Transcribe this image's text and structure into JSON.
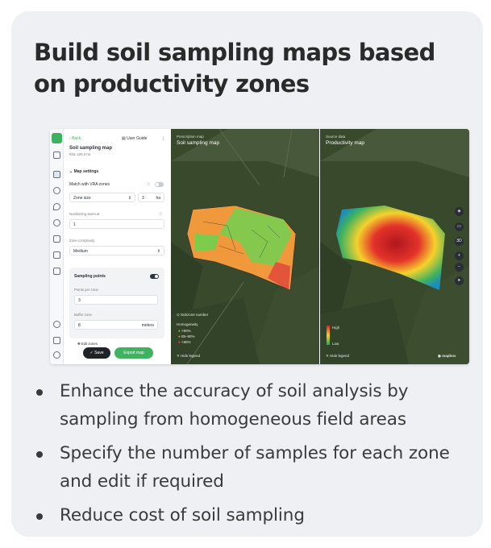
{
  "headline": "Build soil sampling maps based on productivity zones",
  "app_panel": {
    "back_label": "Back",
    "user_guide_label": "User Guide",
    "map_title": "Soil sampling map",
    "map_subtitle": "ENL 105.5 ha",
    "map_settings_label": "Map settings",
    "match_vra_label": "Match with VRA zones",
    "zone_size_label": "Zone size",
    "zone_size_value": "3",
    "zone_size_unit": "ha",
    "numbering_label": "Numbering starts at",
    "numbering_value": "1",
    "zone_complexity_label": "Zone complexity",
    "zone_complexity_value": "Medium",
    "sampling_points_label": "Sampling points",
    "points_per_zone_label": "Points per zone",
    "points_per_zone_value": "3",
    "buffer_zone_label": "Buffer zone",
    "buffer_zone_value": "8",
    "buffer_zone_unit": "meters",
    "edit_zones_label": "Edit zones",
    "save_label": "Save",
    "export_label": "Export map"
  },
  "left_map": {
    "subtitle": "Prescription map",
    "title": "Soil sampling map",
    "subzone_label": "Subzone number",
    "homogeneity_label": "Homogeneity",
    "legend_items": [
      ">90%",
      "85–90%",
      "<85%"
    ],
    "legend_colors": [
      "#7ccb4a",
      "#f0993c",
      "#e2553a"
    ],
    "hide_legend": "Hide legend"
  },
  "right_map": {
    "subtitle": "Source data",
    "title": "Productivity map",
    "high_label": "High",
    "low_label": "Low",
    "hide_legend": "Hide legend",
    "brand": "mapbox",
    "controls": [
      "layers-icon",
      "basemap-icon",
      "3D",
      "+",
      "−",
      "compass-icon"
    ]
  },
  "bullets": [
    "Enhance the accuracy of soil analysis by sampling from homogeneous field areas",
    "Specify the number of samples for each zone and edit if required",
    "Reduce cost of soil sampling"
  ],
  "colors": {
    "accent": "#3fb25f",
    "card_bg": "#eef0f3",
    "dark_button": "#1f2329"
  }
}
